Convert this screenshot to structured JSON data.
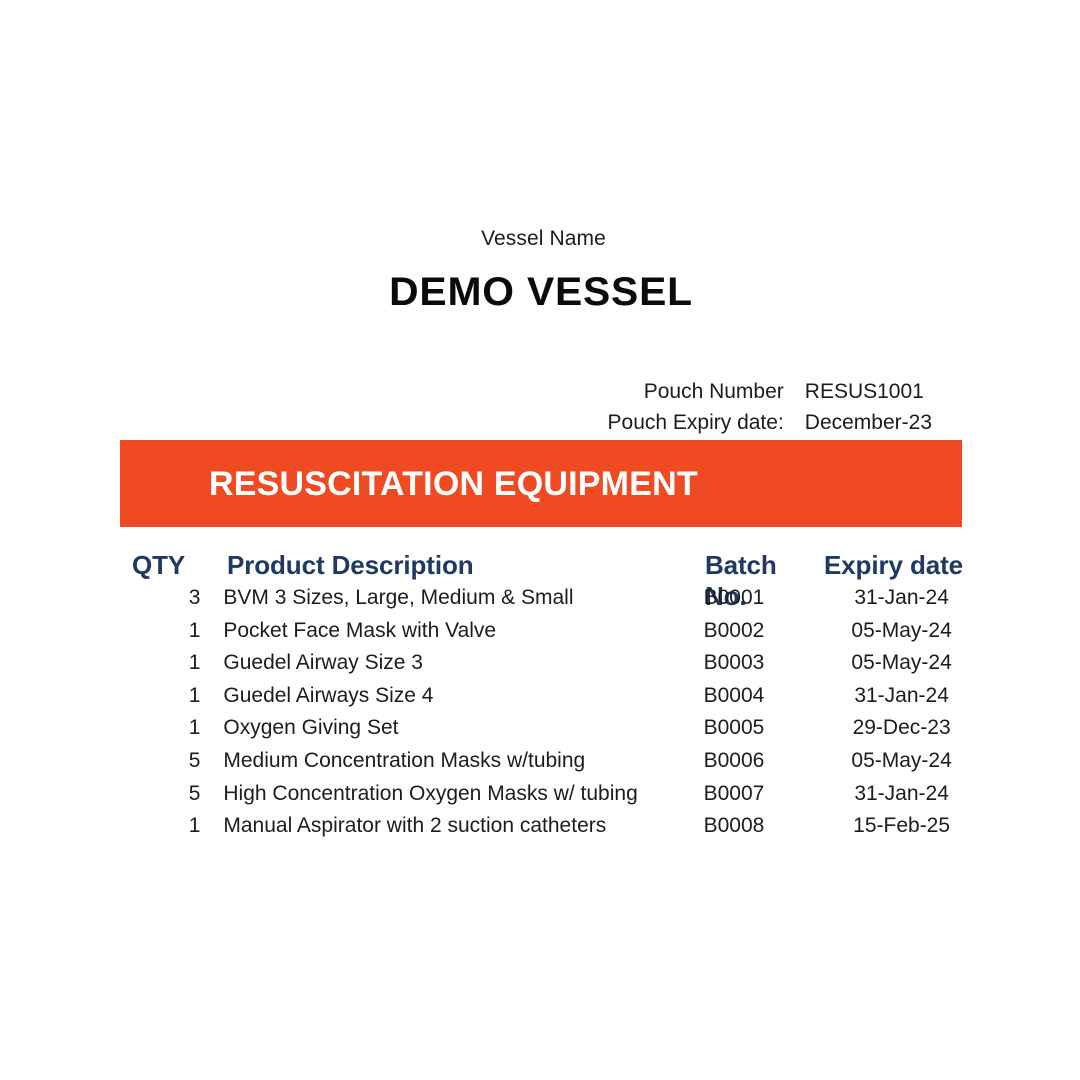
{
  "vessel": {
    "label": "Vessel Name",
    "name": "DEMO VESSEL"
  },
  "pouch": {
    "number_label": "Pouch Number",
    "number_value": "RESUS1001",
    "expiry_label": "Pouch Expiry date:",
    "expiry_value": "December-23"
  },
  "banner": {
    "title": "RESUSCITATION EQUIPMENT",
    "background_color": "#F04A23",
    "text_color": "#FFFFFF"
  },
  "table": {
    "header_color": "#1F3864",
    "columns": {
      "qty": "QTY",
      "description": "Product Description",
      "batch": "Batch No.",
      "expiry": "Expiry date"
    },
    "rows": [
      {
        "qty": "3",
        "description": "BVM 3 Sizes, Large, Medium & Small",
        "batch": "B0001",
        "expiry": "31-Jan-24"
      },
      {
        "qty": "1",
        "description": "Pocket Face Mask with Valve",
        "batch": "B0002",
        "expiry": "05-May-24"
      },
      {
        "qty": "1",
        "description": "Guedel Airway Size 3",
        "batch": "B0003",
        "expiry": "05-May-24"
      },
      {
        "qty": "1",
        "description": "Guedel Airways Size 4",
        "batch": "B0004",
        "expiry": "31-Jan-24"
      },
      {
        "qty": "1",
        "description": "Oxygen Giving Set",
        "batch": "B0005",
        "expiry": "29-Dec-23"
      },
      {
        "qty": "5",
        "description": "Medium Concentration Masks w/tubing",
        "batch": "B0006",
        "expiry": "05-May-24"
      },
      {
        "qty": "5",
        "description": "High Concentration Oxygen Masks w/ tubing",
        "batch": "B0007",
        "expiry": "31-Jan-24"
      },
      {
        "qty": "1",
        "description": "Manual Aspirator with 2 suction catheters",
        "batch": "B0008",
        "expiry": "15-Feb-25"
      }
    ]
  }
}
